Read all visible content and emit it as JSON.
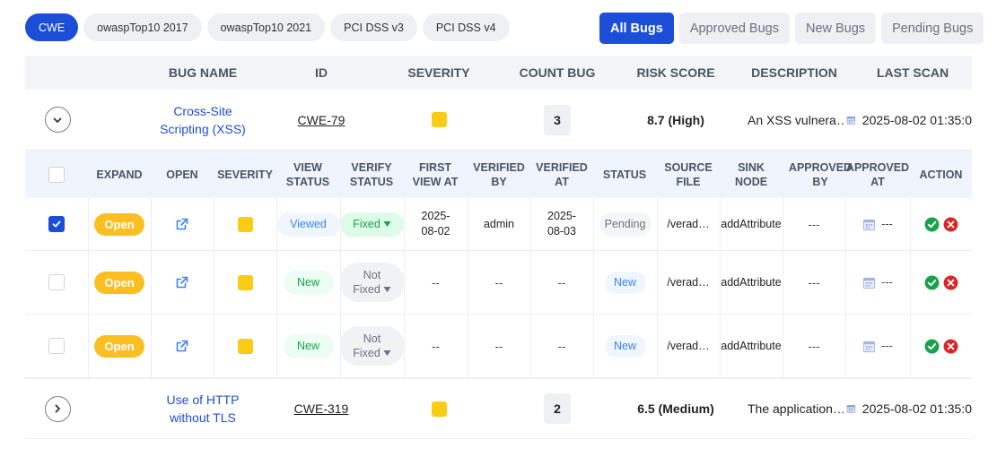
{
  "standard_tabs": [
    {
      "label": "CWE",
      "active": true
    },
    {
      "label": "owaspTop10 2017",
      "active": false
    },
    {
      "label": "owaspTop10 2021",
      "active": false
    },
    {
      "label": "PCI DSS v3",
      "active": false
    },
    {
      "label": "PCI DSS v4",
      "active": false
    }
  ],
  "bug_filter_tabs": [
    {
      "label": "All Bugs",
      "active": true
    },
    {
      "label": "Approved Bugs",
      "active": false
    },
    {
      "label": "New Bugs",
      "active": false
    },
    {
      "label": "Pending Bugs",
      "active": false
    }
  ],
  "main_columns": [
    "BUG NAME",
    "ID",
    "SEVERITY",
    "COUNT BUG",
    "RISK SCORE",
    "DESCRIPTION",
    "LAST SCAN"
  ],
  "bugs": [
    {
      "name_line1": "Cross-Site",
      "name_line2": "Scripting (XSS)",
      "id": "CWE-79",
      "count": "3",
      "risk": "8.7 (High)",
      "description": "An XSS vulnera…",
      "last_scan": "2025-08-02 01:35:0",
      "expanded": true
    },
    {
      "name_line1": "Use of HTTP",
      "name_line2": "without TLS",
      "id": "CWE-319",
      "count": "2",
      "risk": "6.5 (Medium)",
      "description": "The application…",
      "last_scan": "2025-08-02 01:35:0",
      "expanded": false
    }
  ],
  "sub_columns": [
    {
      "l1": "EXPAND",
      "l2": ""
    },
    {
      "l1": "OPEN",
      "l2": ""
    },
    {
      "l1": "SEVERITY",
      "l2": ""
    },
    {
      "l1": "VIEW",
      "l2": "STATUS"
    },
    {
      "l1": "VERIFY",
      "l2": "STATUS"
    },
    {
      "l1": "FIRST",
      "l2": "VIEW AT"
    },
    {
      "l1": "VERIFIED",
      "l2": "BY"
    },
    {
      "l1": "VERIFIED",
      "l2": "AT"
    },
    {
      "l1": "STATUS",
      "l2": ""
    },
    {
      "l1": "SOURCE",
      "l2": "FILE"
    },
    {
      "l1": "SINK",
      "l2": "NODE"
    },
    {
      "l1": "APPROVED",
      "l2": "BY"
    },
    {
      "l1": "APPROVED",
      "l2": "AT"
    },
    {
      "l1": "ACTION",
      "l2": ""
    }
  ],
  "instances": [
    {
      "checked": true,
      "expand_label": "Open",
      "view_status": "Viewed",
      "verify_l1": "Fixed",
      "verify_l2": "",
      "first_view_l1": "2025-",
      "first_view_l2": "08-02",
      "verified_by": "admin",
      "verified_at_l1": "2025-",
      "verified_at_l2": "08-03",
      "status": "Pending",
      "source_file": "/verad…",
      "sink_node": "addAttribute",
      "approved_by": "---",
      "approved_at": "---"
    },
    {
      "checked": false,
      "expand_label": "Open",
      "view_status": "New",
      "verify_l1": "Not",
      "verify_l2": "Fixed",
      "first_view_l1": "--",
      "first_view_l2": "",
      "verified_by": "--",
      "verified_at_l1": "--",
      "verified_at_l2": "",
      "status": "New",
      "source_file": "/verad…",
      "sink_node": "addAttribute",
      "approved_by": "---",
      "approved_at": "---"
    },
    {
      "checked": false,
      "expand_label": "Open",
      "view_status": "New",
      "verify_l1": "Not",
      "verify_l2": "Fixed",
      "first_view_l1": "--",
      "first_view_l2": "",
      "verified_by": "--",
      "verified_at_l1": "--",
      "verified_at_l2": "",
      "status": "New",
      "source_file": "/verad…",
      "sink_node": "addAttribute",
      "approved_by": "---",
      "approved_at": "---"
    }
  ],
  "colors": {
    "primary": "#1d4ed8",
    "severity_medium": "#facc15",
    "open_badge": "#fbbf24",
    "approve_green": "#16a34a",
    "reject_red": "#dc2626"
  },
  "icons": {
    "expand_collapse": "chevron-down-icon",
    "expand_open": "chevron-right-icon",
    "open_link": "external-link-icon",
    "calendar": "calendar-icon",
    "approve": "check-circle-icon",
    "reject": "x-circle-icon",
    "dropdown": "caret-down-icon"
  }
}
